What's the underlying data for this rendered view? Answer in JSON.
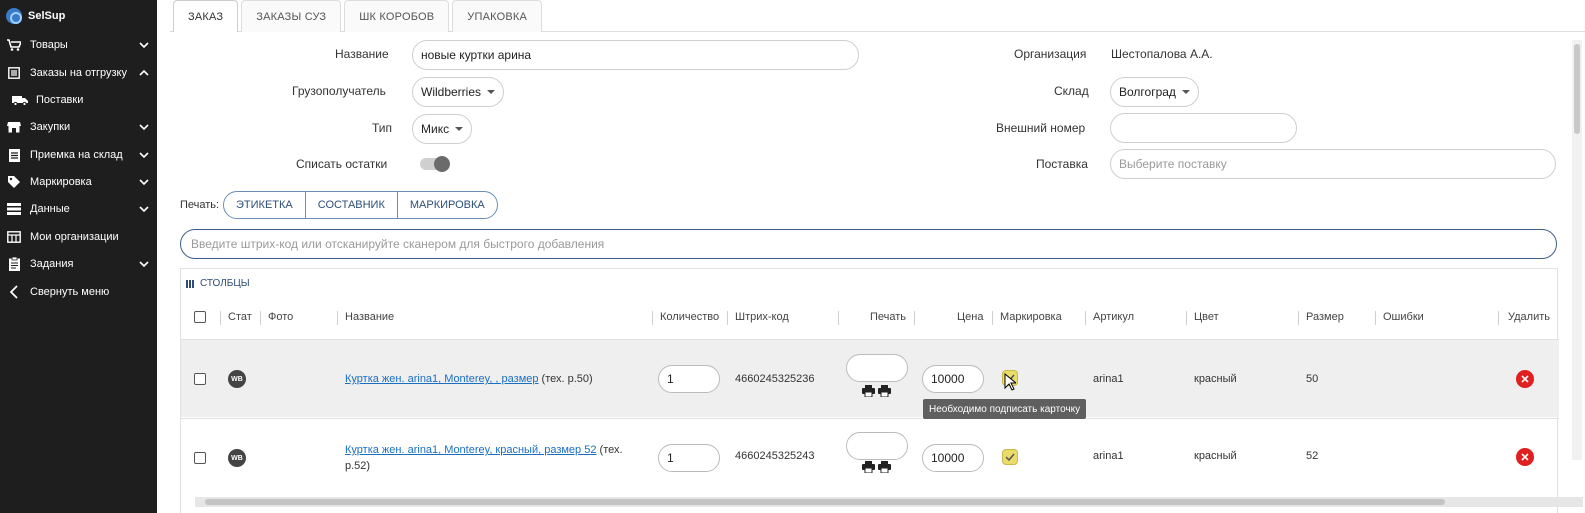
{
  "sidebar": {
    "brand": "SelSup",
    "items": [
      {
        "label": "Товары",
        "icon": "cart-icon",
        "chevron": "down"
      },
      {
        "label": "Заказы на отгрузку",
        "icon": "list-icon",
        "chevron": "up"
      },
      {
        "label": "Поставки",
        "icon": "truck-icon",
        "chevron": ""
      },
      {
        "label": "Закупки",
        "icon": "store-icon",
        "chevron": "down"
      },
      {
        "label": "Приемка на склад",
        "icon": "document-icon",
        "chevron": "down"
      },
      {
        "label": "Маркировка",
        "icon": "tag-icon",
        "chevron": "down"
      },
      {
        "label": "Данные",
        "icon": "table-icon",
        "chevron": "down"
      },
      {
        "label": "Мои организации",
        "icon": "building-icon",
        "chevron": ""
      },
      {
        "label": "Задания",
        "icon": "clipboard-icon",
        "chevron": "down"
      },
      {
        "label": "Свернуть меню",
        "icon": "chevron-left-icon",
        "chevron": ""
      }
    ]
  },
  "tabs": [
    "ЗАКАЗ",
    "ЗАКАЗЫ СУЗ",
    "ШК КОРОБОВ",
    "УПАКОВКА"
  ],
  "form": {
    "name_label": "Название",
    "name_value": "новые куртки арина",
    "consignee_label": "Грузополучатель",
    "consignee_value": "Wildberries",
    "type_label": "Тип",
    "type_value": "Микс",
    "writeoff_label": "Списать остатки",
    "org_label": "Организация",
    "org_value": "Шестопалова А.А.",
    "warehouse_label": "Склад",
    "warehouse_value": "Волгоград",
    "external_label": "Внешний номер",
    "external_value": "",
    "supply_label": "Поставка",
    "supply_placeholder": "Выберите поставку"
  },
  "print": {
    "label": "Печать:",
    "buttons": [
      "ЭТИКЕТКА",
      "СОСТАВНИК",
      "МАРКИРОВКА"
    ]
  },
  "scan_placeholder": "Введите штрих-код или отсканируйте сканером для быстрого добавления",
  "table": {
    "columns_button": "СТОЛБЦЫ",
    "headers": {
      "stat": "Стат",
      "photo": "Фото",
      "name": "Название",
      "qty": "Количество",
      "barcode": "Штрих-код",
      "print": "Печать",
      "price": "Цена",
      "marking": "Маркировка",
      "article": "Артикул",
      "color": "Цвет",
      "size": "Размер",
      "errors": "Ошибки",
      "delete": "Удалить"
    },
    "rows": [
      {
        "stat": "WB",
        "name_link": "Куртка жен. arina1, Monterey, , размер",
        "name_suffix": " (тех. р.50)",
        "qty": "1",
        "barcode": "4660245325236",
        "price": "10000",
        "article": "arina1",
        "color": "красный",
        "size": "50"
      },
      {
        "stat": "WB",
        "name_link": "Куртка жен. arina1, Monterey, красный, размер 52",
        "name_suffix": " (тех. р.52)",
        "qty": "1",
        "barcode": "4660245325243",
        "price": "10000",
        "article": "arina1",
        "color": "красный",
        "size": "52"
      }
    ],
    "tooltip": "Необходимо подписать карточку"
  },
  "colors": {
    "sidebar_bg": "#1e1e1e",
    "accent": "#2d4e78",
    "link": "#1a6fc2",
    "delete": "#e02020",
    "marking_badge": "#e9dc6a"
  }
}
